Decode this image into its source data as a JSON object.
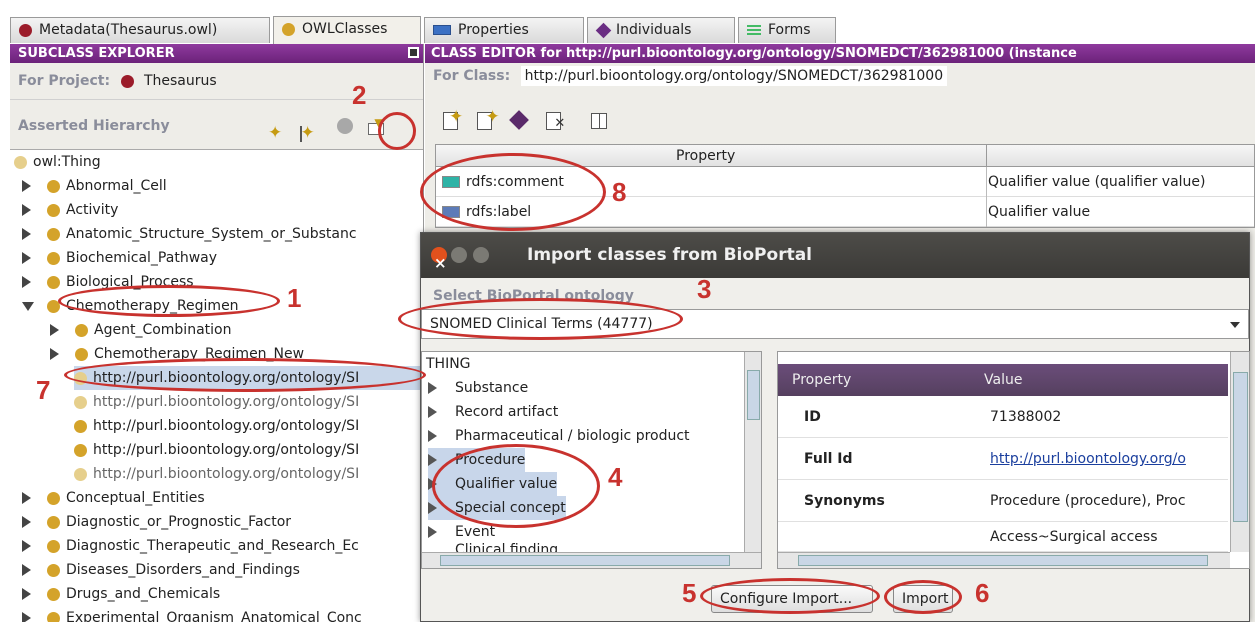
{
  "tabs": [
    {
      "label": "Metadata(Thesaurus.owl)",
      "icon": "red-circle-icon"
    },
    {
      "label": "OWLClasses",
      "icon": "gold-circle-icon"
    },
    {
      "label": "Properties",
      "icon": "property-icon"
    },
    {
      "label": "Individuals",
      "icon": "diamond-icon"
    },
    {
      "label": "Forms",
      "icon": "forms-icon"
    }
  ],
  "subclass_explorer": {
    "title": "SUBCLASS EXPLORER",
    "project_label": "For Project:",
    "project_name": "Thesaurus",
    "hierarchy_label": "Asserted Hierarchy",
    "tree": [
      {
        "label": "owl:Thing"
      },
      {
        "label": "Abnormal_Cell"
      },
      {
        "label": "Activity"
      },
      {
        "label": "Anatomic_Structure_System_or_Substanc"
      },
      {
        "label": "Biochemical_Pathway"
      },
      {
        "label": "Biological_Process"
      },
      {
        "label": "Chemotherapy_Regimen"
      },
      {
        "label": "Agent_Combination"
      },
      {
        "label": "Chemotherapy_Regimen_New"
      },
      {
        "label": "http://purl.bioontology.org/ontology/SI"
      },
      {
        "label": "http://purl.bioontology.org/ontology/SI"
      },
      {
        "label": "http://purl.bioontology.org/ontology/SI"
      },
      {
        "label": "http://purl.bioontology.org/ontology/SI"
      },
      {
        "label": "http://purl.bioontology.org/ontology/SI"
      },
      {
        "label": "Conceptual_Entities"
      },
      {
        "label": "Diagnostic_or_Prognostic_Factor"
      },
      {
        "label": "Diagnostic_Therapeutic_and_Research_Ec"
      },
      {
        "label": "Diseases_Disorders_and_Findings"
      },
      {
        "label": "Drugs_and_Chemicals"
      },
      {
        "label": "Experimental_Organism_Anatomical_Conc"
      }
    ]
  },
  "class_editor": {
    "title": "CLASS EDITOR for http://purl.bioontology.org/ontology/SNOMEDCT/362981000   (instance",
    "for_class_label": "For Class:",
    "for_class_value": "http://purl.bioontology.org/ontology/SNOMEDCT/362981000",
    "table_header": "Property",
    "rows": [
      {
        "property": "rdfs:comment",
        "value": "Qualifier value (qualifier value)"
      },
      {
        "property": "rdfs:label",
        "value": "Qualifier value"
      }
    ]
  },
  "dialog": {
    "title": "Import classes from BioPortal",
    "select_label": "Select BioPortal ontology",
    "selected_ontology": "SNOMED Clinical Terms (44777)",
    "tree_root": "THING",
    "tree_items": [
      "Substance",
      "Record artifact",
      "Pharmaceutical / biologic product",
      "Procedure",
      "Qualifier value",
      "Special concept",
      "Event",
      "Clinical finding"
    ],
    "detail_header": {
      "property": "Property",
      "value": "Value"
    },
    "detail_rows": [
      {
        "key": "ID",
        "value": "71388002"
      },
      {
        "key": "Full Id",
        "value": "http://purl.bioontology.org/o"
      },
      {
        "key": "Synonyms",
        "value": "Procedure (procedure), Proc"
      },
      {
        "key": "",
        "value": "Access~Surgical access"
      }
    ],
    "configure_button": "Configure Import...",
    "import_button": "Import"
  },
  "annotations": [
    "1",
    "2",
    "3",
    "4",
    "5",
    "6",
    "7",
    "8"
  ],
  "colors": {
    "annotation": "#c8322e",
    "panel_header": "#7a2a8a",
    "selection": "#c9d7ea"
  }
}
